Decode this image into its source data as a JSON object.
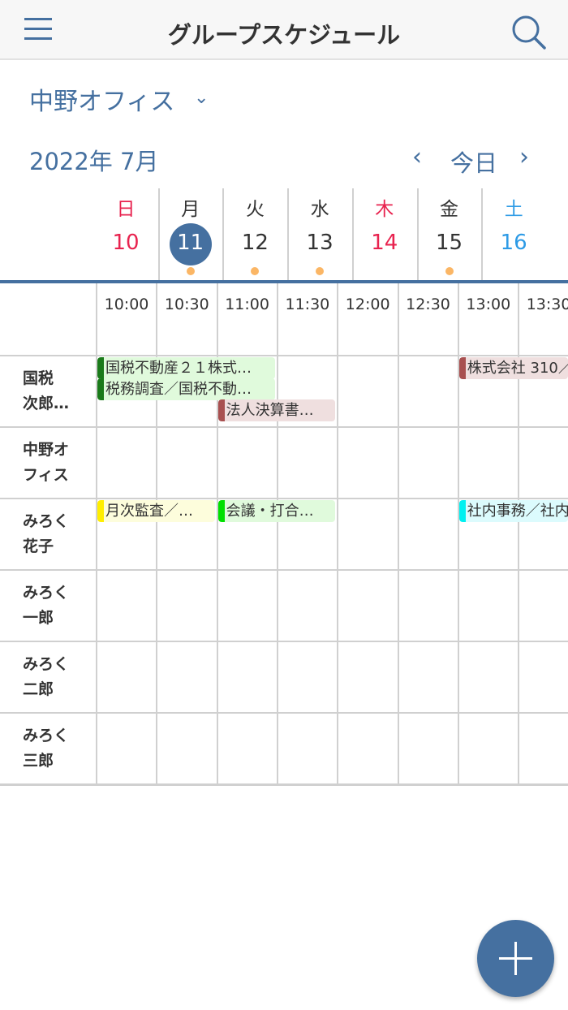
{
  "header": {
    "title": "グループスケジュール",
    "menu_icon": "hamburger-icon",
    "search_icon": "search-icon"
  },
  "office": {
    "label": "中野オフィス",
    "chevron": "⌄"
  },
  "nav": {
    "month": "2022年  7月",
    "prev": "‹",
    "today": "今日",
    "next": "›"
  },
  "week": [
    {
      "dow": "日",
      "day": "10",
      "color": "#e8234f",
      "dot": false
    },
    {
      "dow": "月",
      "day": "11",
      "color": "#333333",
      "dot": true,
      "selected": true
    },
    {
      "dow": "火",
      "day": "12",
      "color": "#333333",
      "dot": true
    },
    {
      "dow": "水",
      "day": "13",
      "color": "#333333",
      "dot": true
    },
    {
      "dow": "木",
      "day": "14",
      "color": "#e8234f",
      "dot": false
    },
    {
      "dow": "金",
      "day": "15",
      "color": "#333333",
      "dot": true
    },
    {
      "dow": "土",
      "day": "16",
      "color": "#2e9be6",
      "dot": false
    }
  ],
  "times": [
    "10:00",
    "10:30",
    "11:00",
    "11:30",
    "12:00",
    "12:30",
    "13:00",
    "13:30"
  ],
  "members": [
    {
      "l1": "国税",
      "l2": "次郎…"
    },
    {
      "l1": "中野オ",
      "l2": "フィス"
    },
    {
      "l1": "みろく",
      "l2": "花子"
    },
    {
      "l1": "みろく",
      "l2": "一郎"
    },
    {
      "l1": "みろく",
      "l2": "二郎"
    },
    {
      "l1": "みろく",
      "l2": "三郎"
    }
  ],
  "events": [
    {
      "title": "国税不動産２１株式…",
      "row": 0,
      "start": 0,
      "span": 3,
      "lane": 0,
      "bg": "#e0fadc",
      "bar": "#1a7a1a"
    },
    {
      "title": "税務調査／国税不動…",
      "row": 0,
      "start": 0,
      "span": 3,
      "lane": 1,
      "bg": "#e0fadc",
      "bar": "#1a7a1a"
    },
    {
      "title": "法人決算書…",
      "row": 0,
      "start": 2,
      "span": 2,
      "lane": 2,
      "bg": "#efdfdf",
      "bar": "#a85050"
    },
    {
      "title": "株式会社 310／",
      "row": 0,
      "start": 6,
      "span": 2,
      "lane": 0,
      "bg": "#efdfdf",
      "bar": "#a85050"
    },
    {
      "title": "月次監査／…",
      "row": 2,
      "start": 0,
      "span": 2,
      "lane": 0,
      "bg": "#fdfddc",
      "bar": "#ffee00"
    },
    {
      "title": "会議・打合…",
      "row": 2,
      "start": 2,
      "span": 2,
      "lane": 0,
      "bg": "#e0fadc",
      "bar": "#00e000"
    },
    {
      "title": "社内事務／社内",
      "row": 2,
      "start": 6,
      "span": 2,
      "lane": 0,
      "bg": "#dcfbfd",
      "bar": "#00f0f0"
    }
  ],
  "fab": {
    "icon": "plus-icon"
  }
}
